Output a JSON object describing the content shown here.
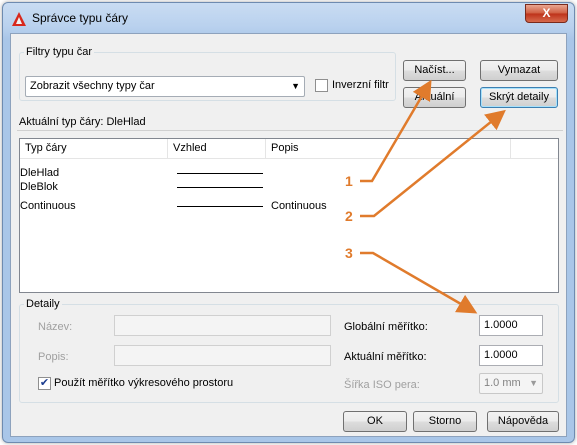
{
  "window": {
    "title": "Správce typu čáry",
    "close_label": "X"
  },
  "filters": {
    "group_label": "Filtry typu čar",
    "selected": "Zobrazit všechny typy čar",
    "invert_label": "Inverzní filtr",
    "invert_checked": false
  },
  "buttons": {
    "load": "Načíst...",
    "delete": "Vymazat",
    "current": "Aktuální",
    "hide_details": "Skrýt detaily"
  },
  "current_linetype": {
    "label": "Aktuální typ čáry:",
    "value": "DleHlad"
  },
  "linetype_list": {
    "columns": [
      "Typ čáry",
      "Vzhled",
      "Popis"
    ],
    "rows": [
      {
        "name": "DleHlad",
        "description": ""
      },
      {
        "name": "DleBlok",
        "description": ""
      },
      {
        "name": "Continuous",
        "description": "Continuous"
      }
    ]
  },
  "details": {
    "group_label": "Detaily",
    "name_label": "Název:",
    "name_value": "",
    "description_label": "Popis:",
    "description_value": "",
    "use_paper_space_label": "Použít měřítko výkresového prostoru",
    "use_paper_space_checked": true,
    "global_scale_label": "Globální měřítko:",
    "global_scale_value": "1.0000",
    "current_scale_label": "Aktuální měřítko:",
    "current_scale_value": "1.0000",
    "iso_pen_label": "Šířka ISO pera:",
    "iso_pen_value": "1.0 mm"
  },
  "footer": {
    "ok": "OK",
    "cancel": "Storno",
    "help": "Nápověda"
  },
  "callouts": [
    "1",
    "2",
    "3"
  ],
  "colors": {
    "callout": "#e07b2c",
    "title_icon": "#d8281c",
    "close_button": "#c8452b"
  }
}
